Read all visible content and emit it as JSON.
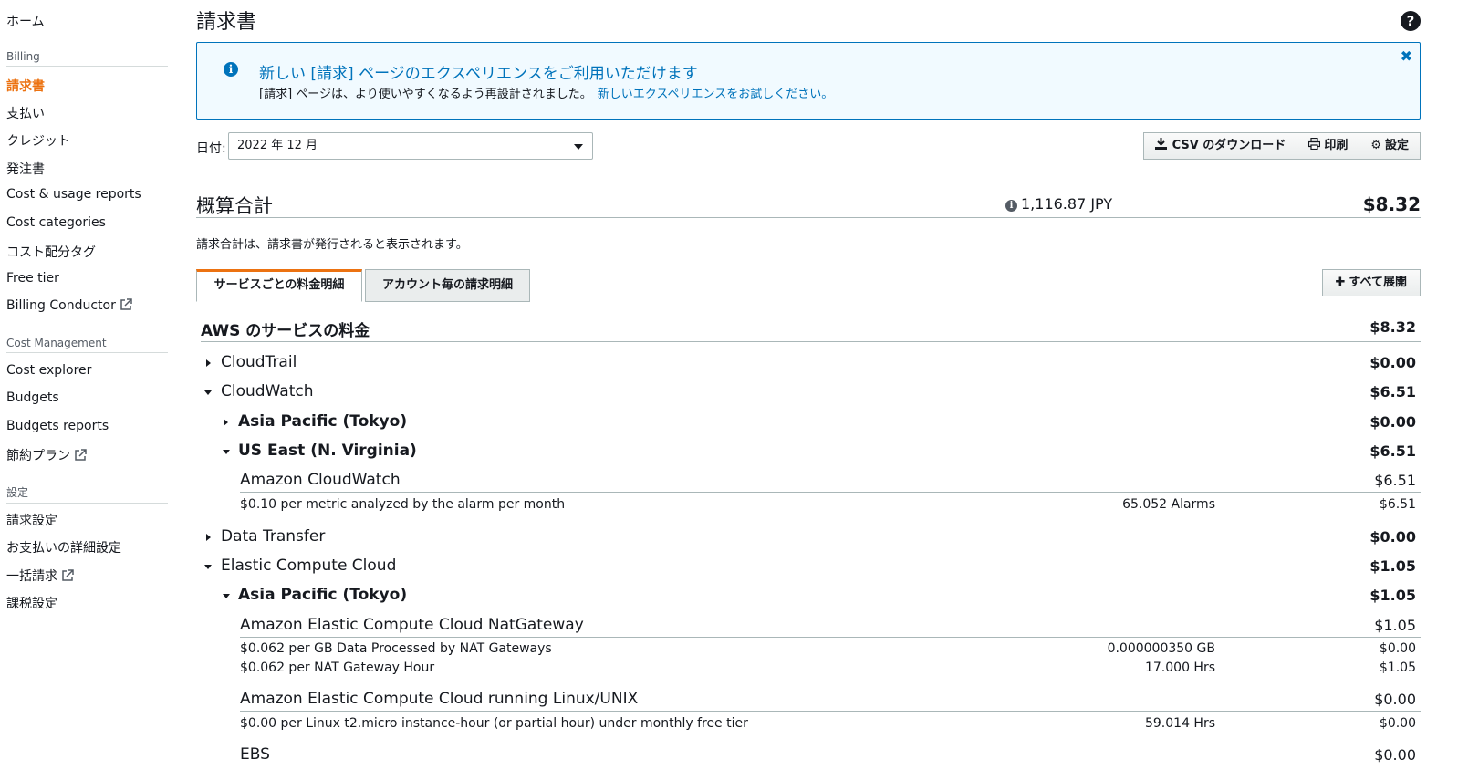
{
  "sidebar": {
    "items": [
      {
        "label": "ホーム"
      },
      {
        "section": "Billing"
      },
      {
        "label": "請求書",
        "active": true
      },
      {
        "label": "支払い"
      },
      {
        "label": "クレジット"
      },
      {
        "label": "発注書"
      },
      {
        "label": "Cost & usage reports"
      },
      {
        "label": "Cost categories"
      },
      {
        "label": "コスト配分タグ"
      },
      {
        "label": "Free tier"
      },
      {
        "label": "Billing Conductor",
        "external": true
      },
      {
        "section": "Cost Management"
      },
      {
        "label": "Cost explorer"
      },
      {
        "label": "Budgets"
      },
      {
        "label": "Budgets reports"
      },
      {
        "label": "節約プラン",
        "external": true
      },
      {
        "section": "設定"
      },
      {
        "label": "請求設定"
      },
      {
        "label": "お支払いの詳細設定"
      },
      {
        "label": "一括請求",
        "external": true
      },
      {
        "label": "課税設定"
      }
    ]
  },
  "page": {
    "title": "請求書",
    "help_icon": "?"
  },
  "banner": {
    "title": "新しい [請求] ページのエクスペリエンスをご利用いただけます",
    "text": "[請求] ページは、より使いやすくなるよう再設計されました。",
    "link": "新しいエクスペリエンスをお試しください。",
    "close": "✖"
  },
  "toolbar": {
    "date_label": "日付:",
    "date_value": "2022 年 12 月",
    "csv_label": "CSV のダウンロード",
    "print_label": "印刷",
    "settings_label": "設定"
  },
  "total": {
    "title": "概算合計",
    "jpy": "1,116.87 JPY",
    "usd": "$8.32",
    "note": "請求合計は、請求書が発行されると表示されます。"
  },
  "tabs": [
    {
      "label": "サービスごとの料金明細",
      "active": true
    },
    {
      "label": "アカウント毎の請求明細",
      "active": false
    }
  ],
  "expand_all": "すべて展開",
  "charges": {
    "header": {
      "label": "AWS のサービスの料金",
      "amount": "$8.32"
    },
    "rows": [
      {
        "kind": "service",
        "label": "CloudTrail",
        "amount": "$0.00",
        "expanded": false
      },
      {
        "kind": "service",
        "label": "CloudWatch",
        "amount": "$6.51",
        "expanded": true
      },
      {
        "kind": "region",
        "label": "Asia Pacific (Tokyo)",
        "amount": "$0.00",
        "expanded": false
      },
      {
        "kind": "region",
        "label": "US East (N. Virginia)",
        "amount": "$6.51",
        "expanded": true
      },
      {
        "kind": "product",
        "label": "Amazon CloudWatch",
        "amount": "$6.51"
      },
      {
        "kind": "line",
        "label": "$0.10 per metric analyzed by the alarm per month",
        "quantity": "65.052 Alarms",
        "amount": "$6.51"
      },
      {
        "kind": "service",
        "label": "Data Transfer",
        "amount": "$0.00",
        "expanded": false
      },
      {
        "kind": "service",
        "label": "Elastic Compute Cloud",
        "amount": "$1.05",
        "expanded": true
      },
      {
        "kind": "region",
        "label": "Asia Pacific (Tokyo)",
        "amount": "$1.05",
        "expanded": true
      },
      {
        "kind": "product",
        "label": "Amazon Elastic Compute Cloud NatGateway",
        "amount": "$1.05"
      },
      {
        "kind": "line",
        "label": "$0.062 per GB Data Processed by NAT Gateways",
        "quantity": "0.000000350 GB",
        "amount": "$0.00"
      },
      {
        "kind": "line",
        "label": "$0.062 per NAT Gateway Hour",
        "quantity": "17.000 Hrs",
        "amount": "$1.05"
      },
      {
        "kind": "product",
        "label": "Amazon Elastic Compute Cloud running Linux/UNIX",
        "amount": "$0.00"
      },
      {
        "kind": "line",
        "label": "$0.00 per Linux t2.micro instance-hour (or partial hour) under monthly free tier",
        "quantity": "59.014 Hrs",
        "amount": "$0.00"
      },
      {
        "kind": "product",
        "label": "EBS",
        "amount": "$0.00"
      }
    ]
  }
}
